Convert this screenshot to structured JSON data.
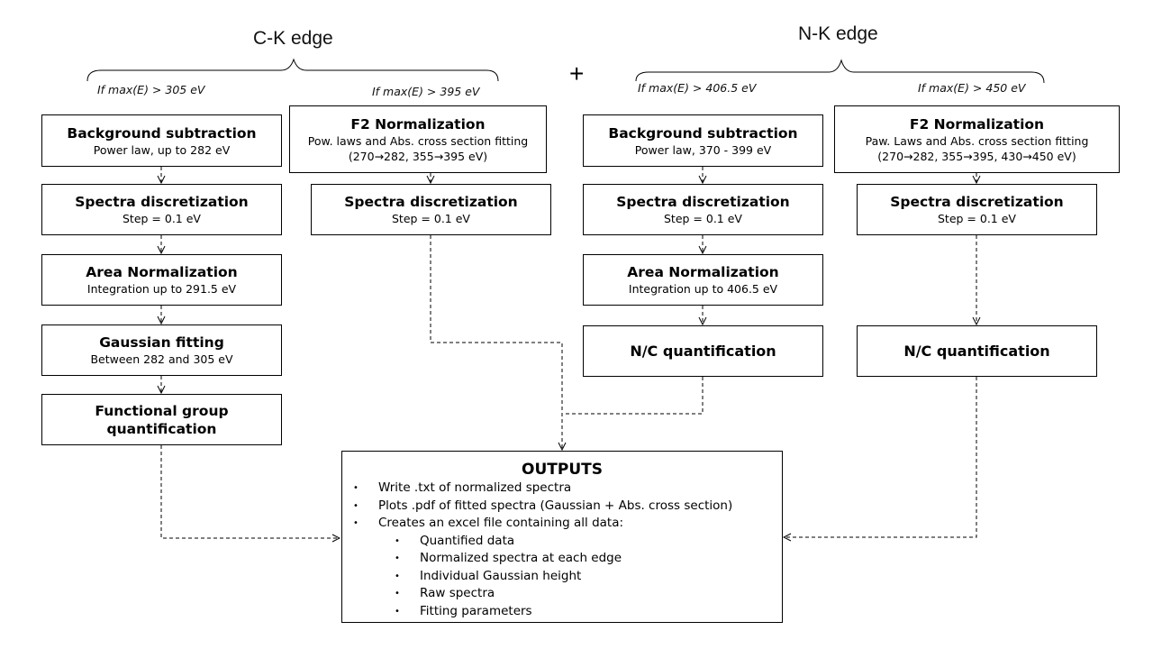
{
  "edges": {
    "carbon": {
      "title": "C-K edge",
      "branches": [
        {
          "condition": "If max(E) > 305 eV",
          "steps": [
            {
              "title": "Background subtraction",
              "subtitle": "Power law, up to 282 eV"
            },
            {
              "title": "Spectra discretization",
              "subtitle": "Step = 0.1 eV"
            },
            {
              "title": "Area Normalization",
              "subtitle": "Integration up to 291.5 eV"
            },
            {
              "title": "Gaussian fitting",
              "subtitle": "Between  282 and 305 eV"
            },
            {
              "title": "Functional group quantification",
              "title_line1": "Functional group",
              "title_line2": "quantification"
            }
          ]
        },
        {
          "condition": "If max(E) > 395 eV",
          "steps": [
            {
              "title": "F2 Normalization",
              "subtitle": "Pow. laws and Abs. cross section fitting",
              "subtitle2": "(270→282, 355→395 eV)"
            },
            {
              "title": "Spectra discretization",
              "subtitle": "Step = 0.1 eV"
            }
          ]
        }
      ]
    },
    "connector": "+",
    "nitrogen": {
      "title": "N-K edge",
      "branches": [
        {
          "condition": "If max(E) > 406.5 eV",
          "steps": [
            {
              "title": "Background subtraction",
              "subtitle": "Power law, 370 - 399 eV"
            },
            {
              "title": "Spectra discretization",
              "subtitle": "Step = 0.1 eV"
            },
            {
              "title": "Area Normalization",
              "subtitle": "Integration up to 406.5 eV"
            },
            {
              "title": "N/C quantification"
            }
          ]
        },
        {
          "condition": "If max(E) > 450 eV",
          "steps": [
            {
              "title": "F2 Normalization",
              "subtitle": "Paw. Laws and Abs. cross section fitting",
              "subtitle2": "(270→282, 355→395, 430→450 eV)"
            },
            {
              "title": "Spectra discretization",
              "subtitle": "Step = 0.1 eV"
            },
            {
              "title": "N/C quantification"
            }
          ]
        }
      ]
    }
  },
  "outputs": {
    "title": "OUTPUTS",
    "items": [
      "Write .txt of normalized spectra",
      "Plots .pdf of fitted spectra (Gaussian + Abs. cross section)",
      "Creates an excel file containing all data:"
    ],
    "excel_contents": [
      "Quantified data",
      "Normalized spectra at each edge",
      "Individual Gaussian height",
      "Raw spectra",
      "Fitting parameters"
    ],
    "bullet": "•"
  }
}
